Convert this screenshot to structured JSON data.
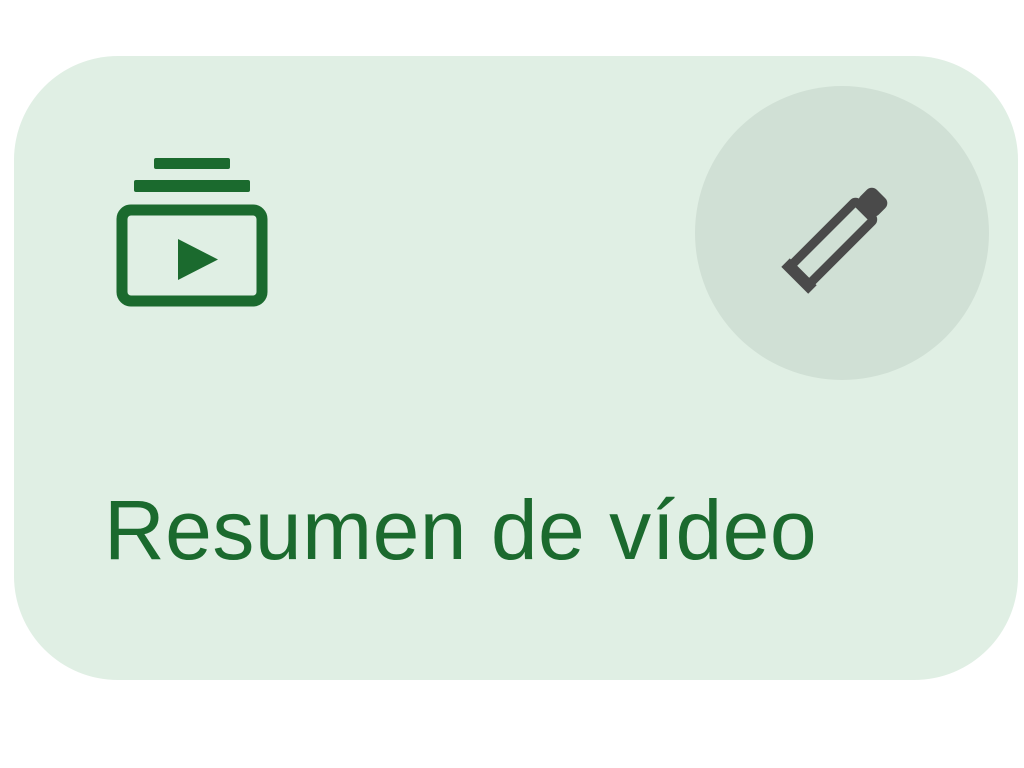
{
  "card": {
    "label": "Resumen de vídeo",
    "icon": "video-library-icon",
    "accent_color": "#1b6a2e",
    "background_color": "#e0efe4"
  },
  "edit_button": {
    "icon": "pencil-icon",
    "background_color": "#d0e0d5",
    "icon_color": "#4a4a4a"
  }
}
